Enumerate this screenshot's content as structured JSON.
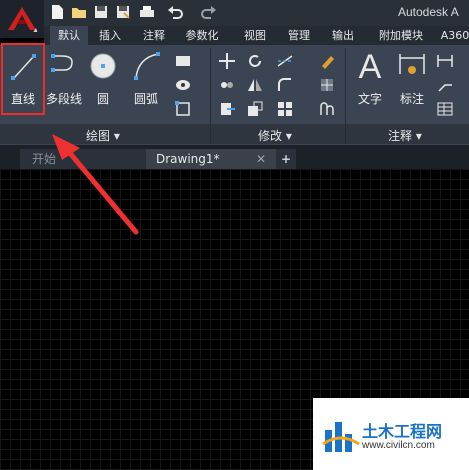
{
  "app": {
    "title": "Autodesk A",
    "logo": "autocad-a-logo"
  },
  "qat_icons": [
    "new-icon",
    "open-icon",
    "save-icon",
    "saveas-icon",
    "print-icon",
    "undo-icon",
    "redo-icon"
  ],
  "tabs": [
    "默认",
    "插入",
    "注释",
    "参数化",
    "视图",
    "管理",
    "输出",
    "附加模块",
    "A360"
  ],
  "draw_panel": {
    "title": "绘图",
    "buttons": [
      {
        "label": "直线",
        "icon": "line-icon"
      },
      {
        "label": "多段线",
        "icon": "polyline-icon"
      },
      {
        "label": "圆",
        "icon": "circle-icon"
      },
      {
        "label": "圆弧",
        "icon": "arc-icon"
      }
    ]
  },
  "modify_panel": {
    "title": "修改"
  },
  "annotate_panel": {
    "title": "注释",
    "buttons": [
      {
        "label": "文字",
        "icon": "text-icon"
      },
      {
        "label": "标注",
        "icon": "dimension-icon"
      }
    ]
  },
  "doc_tabs": [
    {
      "label": "开始"
    },
    {
      "label": "Drawing1*"
    }
  ],
  "watermark": {
    "text": "土木工程网",
    "url": "www.civilcn.com"
  },
  "colors": {
    "ribbon": "#3b4452",
    "highlight": "#ee2c2c",
    "canvas": "#000000",
    "accent": "#c4161c"
  }
}
